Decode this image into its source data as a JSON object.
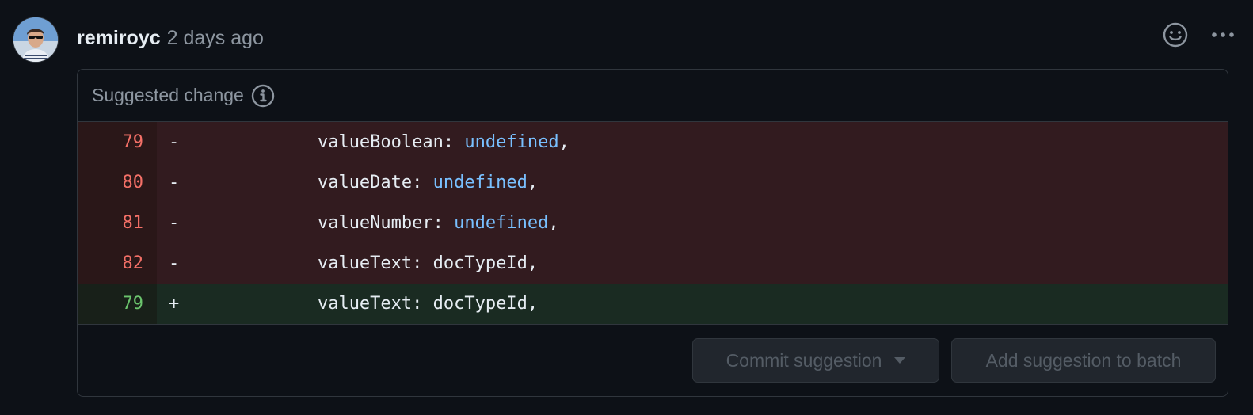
{
  "comment": {
    "author": "remiroyc",
    "timestamp": "2 days ago",
    "avatar_icon": "user-avatar",
    "actions": [
      {
        "icon": "smiley-icon"
      },
      {
        "icon": "kebab-horizontal-icon"
      }
    ]
  },
  "suggestion": {
    "title": "Suggested change",
    "info_icon": "info-icon",
    "lines": [
      {
        "type": "del",
        "number": "79",
        "sign": "-",
        "indent": "            ",
        "key": "valueBoolean: ",
        "value": "undefined",
        "value_is_keyword": true,
        "suffix": ","
      },
      {
        "type": "del",
        "number": "80",
        "sign": "-",
        "indent": "            ",
        "key": "valueDate: ",
        "value": "undefined",
        "value_is_keyword": true,
        "suffix": ","
      },
      {
        "type": "del",
        "number": "81",
        "sign": "-",
        "indent": "            ",
        "key": "valueNumber: ",
        "value": "undefined",
        "value_is_keyword": true,
        "suffix": ","
      },
      {
        "type": "del",
        "number": "82",
        "sign": "-",
        "indent": "            ",
        "key": "valueText: ",
        "value": "docTypeId",
        "value_is_keyword": false,
        "suffix": ","
      },
      {
        "type": "add",
        "number": "79",
        "sign": "+",
        "indent": "            ",
        "key": "valueText: ",
        "value": "docTypeId",
        "value_is_keyword": false,
        "suffix": ","
      }
    ],
    "commit_button": "Commit suggestion",
    "batch_button": "Add suggestion to batch"
  },
  "colors": {
    "background": "#0d1117",
    "border": "#30363d",
    "deletion_bg": "#321b1f",
    "deletion_number": "#f47067",
    "addition_bg": "#1a2b22",
    "addition_number": "#6bc46d",
    "keyword": "#79c0ff",
    "muted_text": "#8d96a0",
    "disabled_text": "#545c65"
  }
}
